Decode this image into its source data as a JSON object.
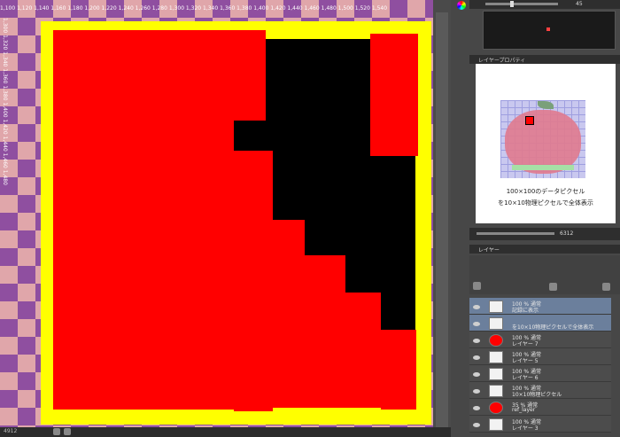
{
  "ruler": {
    "top_label": "1,100 1,120 1,140 1,160 1,180 1,200 1,220 1,240 1,260 1,280 1,300 1,320 1,340 1,360 1,380 1,400 1,420 1,440 1,460 1,480 1,500 1,520 1,540",
    "left_label": "1,300 1,320 1,340 1,360 1,380 1,400 1,420 1,440 1,460 1,480"
  },
  "statusbar": {
    "zoom": "4912"
  },
  "navigator": {
    "zoom_value": "45",
    "caption_line1": "100×100のデータピクセル",
    "caption_line2": "を10×10物理ピクセルで全体表示",
    "bottom_value": "6312"
  },
  "tabs": {
    "layer_tab": "レイヤープロパティ",
    "layer_panel_title": "レイヤー"
  },
  "layers": [
    {
      "line1": "100 % 通常",
      "line2": "記録に表示",
      "selected": true
    },
    {
      "line1": "",
      "line2": "を10×10物理ピクセルで全体表示",
      "selected": true
    },
    {
      "line1": "100 % 通常",
      "line2": "レイヤー 7",
      "selected": false
    },
    {
      "line1": "100 % 通常",
      "line2": "レイヤー 5",
      "selected": false
    },
    {
      "line1": "100 % 通常",
      "line2": "レイヤー 6",
      "selected": false
    },
    {
      "line1": "100 % 通常",
      "line2": "10×10物理ピクセル",
      "selected": false
    },
    {
      "line1": "35 % 通常",
      "line2": "ref_layer",
      "selected": false
    },
    {
      "line1": "100 % 通常",
      "line2": "レイヤー 3",
      "selected": false
    }
  ],
  "colors": {
    "canvas_red": "#ff0000",
    "canvas_yellow": "#ffff00",
    "canvas_black": "#000000",
    "checker_purple": "#8f4fa0",
    "checker_pink": "#e0a6aa",
    "selection_blue": "#6b7f9c"
  }
}
